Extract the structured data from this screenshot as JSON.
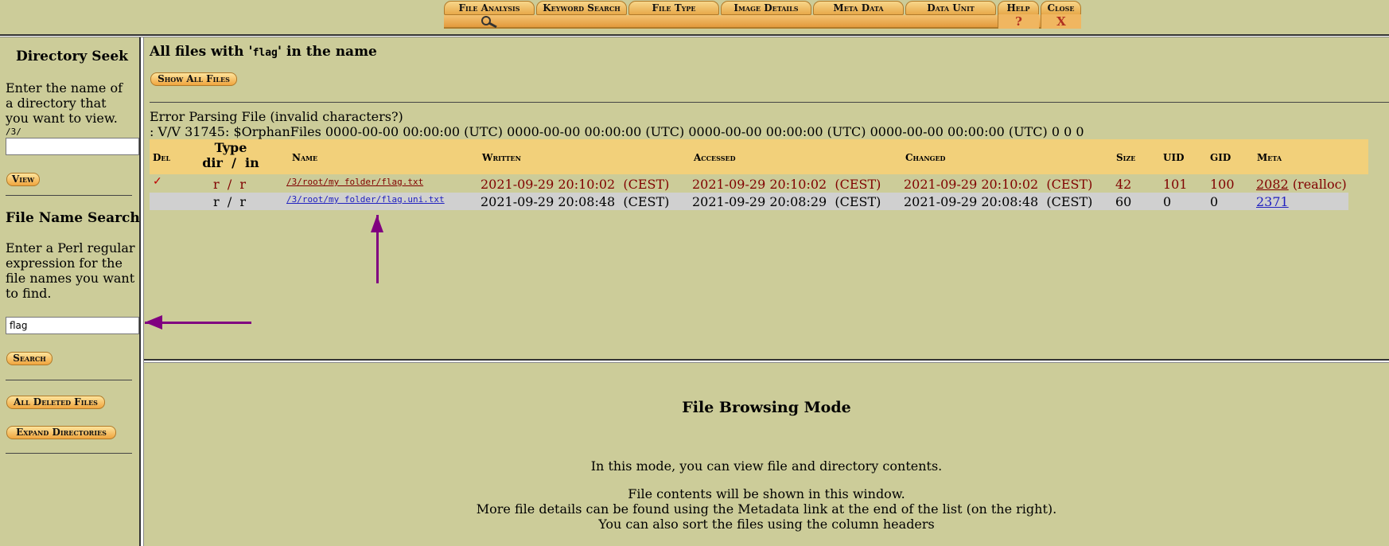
{
  "tabs": {
    "file_analysis": "File Analysis",
    "keyword_search": "Keyword Search",
    "file_type": "File Type",
    "image_details": "Image Details",
    "meta_data": "Meta Data",
    "data_unit": "Data Unit",
    "help": "Help",
    "close": "Close",
    "help_symbol": "?",
    "close_symbol": "X",
    "search_icon": "magnifier-icon"
  },
  "sidebar": {
    "directory_seek_title": "Directory Seek",
    "directory_seek_text": "Enter the name of a directory that you want to view.",
    "current_path": "/3/",
    "dir_input_value": "",
    "view_button": "View",
    "file_name_search_title": "File Name Search",
    "file_name_search_text": "Enter a Perl regular expression for the file names you want to find.",
    "search_input_value": "flag",
    "search_button": "Search",
    "all_deleted_button": "All Deleted Files",
    "expand_dirs_button": "Expand Directories"
  },
  "main": {
    "title_prefix": "All files with '",
    "title_term": "flag",
    "title_suffix": "' in the name",
    "show_all_button": "Show All Files",
    "error_line1": "Error Parsing File (invalid characters?)",
    "error_line2": ": V/V 31745: $OrphanFiles 0000-00-00 00:00:00 (UTC) 0000-00-00 00:00:00 (UTC) 0000-00-00 00:00:00 (UTC) 0000-00-00 00:00:00 (UTC) 0 0 0",
    "table": {
      "headers": {
        "del": "Del",
        "type_line1": "Type",
        "type_line2": "dir  /  in",
        "name": "Name",
        "written": "Written",
        "accessed": "Accessed",
        "changed": "Changed",
        "size": "Size",
        "uid": "UID",
        "gid": "GID",
        "meta": "Meta"
      },
      "rows": [
        {
          "del": "✓",
          "type": "r  /  r",
          "name": "/3/root/my folder/flag.txt",
          "written": "2021-09-29 20:10:02  (CEST)",
          "accessed": "2021-09-29 20:10:02  (CEST)",
          "changed": "2021-09-29 20:10:02  (CEST)",
          "size": "42",
          "uid": "101",
          "gid": "100",
          "meta": "2082",
          "meta_note": "(realloc)"
        },
        {
          "del": "",
          "type": "r  /  r",
          "name": "/3/root/my folder/flag.uni.txt",
          "written": "2021-09-29 20:08:48  (CEST)",
          "accessed": "2021-09-29 20:08:29  (CEST)",
          "changed": "2021-09-29 20:08:48  (CEST)",
          "size": "60",
          "uid": "0",
          "gid": "0",
          "meta": "2371",
          "meta_note": ""
        }
      ]
    }
  },
  "bottom": {
    "title": "File Browsing Mode",
    "line1": "In this mode, you can view file and directory contents.",
    "line2": "File contents will be shown in this window.",
    "line3": "More file details can be found using the Metadata link at the end of the list (on the right).",
    "line4": "You can also sort the files using the column headers"
  },
  "colors": {
    "background": "#cccc99",
    "tab_orange": "#f0b660",
    "header_row": "#f2d07a",
    "deleted_text": "#800000",
    "link": "#2020c0",
    "annotation_arrow": "#800080"
  }
}
